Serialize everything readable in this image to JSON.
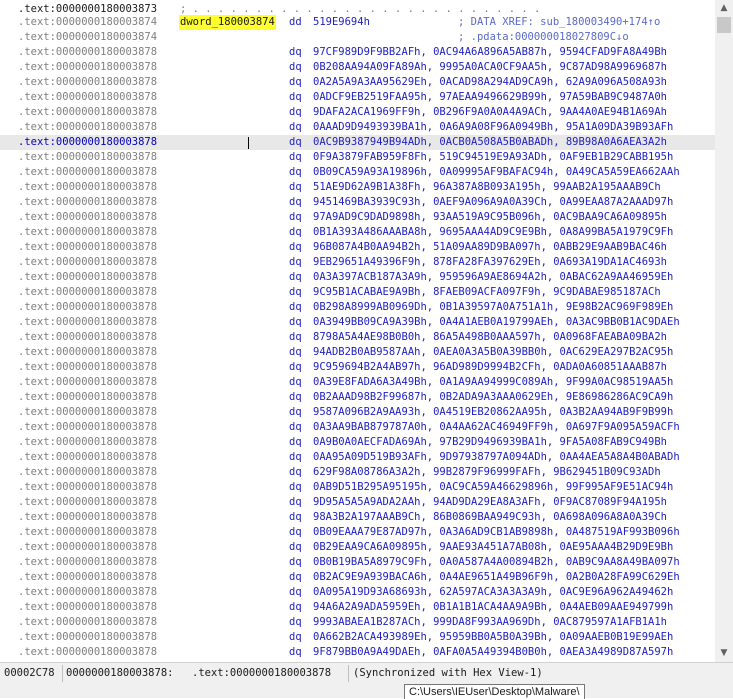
{
  "listing": {
    "header": {
      "address": ".text:0000000180003873",
      "trailing_dots": "; . . . . . . . . . . . . . . . . . . . . . . . . . . . ."
    },
    "label_line": {
      "address": ".text:0000000180003874",
      "label": "dword_180003874",
      "mnemonic": "dd",
      "operand": "519E9694h",
      "comment": "; DATA XREF: sub_180003490+174↑o"
    },
    "comment_line": {
      "address": ".text:0000000180003874",
      "comment": "; .pdata:000000018027809C↓o"
    },
    "row_address": ".text:0000000180003878",
    "mnemonic": "dq",
    "current_index": 6,
    "rows": [
      "97CF989D9F9BB2AFh, 0AC94A6A896A5AB87h, 9594CFAD9FA8A49Bh",
      "0B208AA94A09FA89Ah, 9995A0ACA0CF9AA5h, 9C87AD98A9969687h",
      "0A2A5A9A3AA95629Eh, 0ACAD98A294AD9CA9h, 62A9A096A508A93h",
      "0ADCF9EB2519FAA95h, 97AEAA9496629B99h, 97A59BAB9C9487A0h",
      "9DAFA2ACA1969FF9h, 0B296F9A0A0A4A9ACh, 9AA4A0AE94B1A69Ah",
      "0AAAD9D9493939BA1h, 0A6A9A08F96A0949Bh, 95A1A09DA39B93AFh",
      "0AC9B9387949B94ADh, 0ACB0A508A5B0ABADh, 89B98A0A6AEA3A2h",
      "0F9A3879FAB959F8Fh, 519C94519E9A93ADh, 0AF9EB1B29CABB195h",
      "0B09CA59A93A19896h, 0A09995AF9BAFAC94h, 0A49CA5A59EA662AAh",
      "51AE9D62A9B1A38Fh, 96A387A8B093A195h, 99AAB2A195AAAB9Ch",
      "9451469BA3939C93h, 0AEF9A096A9A0A39Ch, 0A99EAA87A2AAAD97h",
      "97A9AD9C9DAD9898h, 93AA519A9C95B096h, 0AC9BAA9CA6A09895h",
      "0B1A393A486AAABA8h, 9695AAA4AD9C9E9Bh, 0A8A99BA5A1979C9Fh",
      "96B087A4B0AA94B2h, 51A09AA89D9BA097h, 0ABB29E9AAB9BAC46h",
      "9EB29651A49396F9h, 878FA28FA397629Eh, 0A693A19DA1AC4693h",
      "0A3A397ACB187A3A9h, 959596A9AE8694A2h, 0ABAC62A9AA46959Eh",
      "9C95B1ACABAE9A9Bh, 8FAEB09ACFA097F9h, 9C9DABAE985187ACh",
      "0B298A8999AB0969Dh, 0B1A39597A0A751A1h, 9E98B2AC969F989Eh",
      "0A3949BB09CA9A39Bh, 0A4A1AEB0A19799AEh, 0A3AC9BB0B1AC9DAEh",
      "8798A5A4AE98B0B0h, 86A5A498B0AAA597h, 0A0968FAEABA09BA2h",
      "94ADB2B0AB9587AAh, 0AEA0A3A5B0A39BB0h, 0AC629EA297B2AC95h",
      "9C959694B2A4AB97h, 96AD989D9994B2CFh, 0ADA0A60851AAAB87h",
      "0A39E8FADA6A3A49Bh, 0A1A9AA94999C089Ah, 9F99A0AC98519AA5h",
      "0B2AAAD98B2F99687h, 0B2ADA9A3AAA0629Eh, 9E86986286AC9CA9h",
      "9587A096B2A9AA93h, 0A4519EB20862AA95h, 0A3B2AA94AB9F9B99h",
      "0A3AA9BAB879787A0h, 0A4AA62AC46949FF9h, 0A697F9A095A59ACFh",
      "0A9B0A0AECFADA69Ah, 97B29D9496939BA1h, 9FA5A08FAB9C949Bh",
      "0AA95A09D519B93AFh, 9D97938797A094ADh, 0AA4AEA5A8A4B0ABADh",
      "629F98A08786A3A2h, 99B2879F96999FAFh, 9B629451B09C93ADh",
      "0AB9D51B295A95195h, 0AC9CA59A46629896h, 99F995AF9E51AC94h",
      "9D95A5A5A9ADA2AAh, 94AD9DA29EA8A3AFh, 0F9AC87089F94A195h",
      "98A3B2A197AAAB9Ch, 86B0869BAA949C93h, 0A698A096A8A0A39Ch",
      "0B09EAAA79E87AD97h, 0A3A6AD9CB1AB9898h, 0A487519AF993B096h",
      "0B29EAA9CA6A09895h, 9AAE93A451A7AB08h, 0AE95AAA4B29D9E9Bh",
      "0B0B19BA5A8979C9Fh, 0A0A587A4A00894B2h, 0AB9C9AA8A49BA097h",
      "0B2AC9E9A939BACA6h, 0A4AE9651A49B96F9h, 0A2B0A28FA99C629Eh",
      "0A095A19D93A68693h, 62A597ACA3A3A3A9h, 0AC9E96A962A49462h",
      "94A6A2A9ADA5959Eh, 0B1A1B1ACA4AA9A9Bh, 0A4AEB09AAE949799h",
      "9993ABAEA1B287ACh, 999DA8F993AA969Dh, 0AC879597A1AFB1A1h",
      "0A662B2ACA493989Eh, 95959BB0A5B0A39Bh, 0A09AAEB0B19E99AEh",
      "9F879BB0A9A49DAEh, 0AFA0A5A49394B0B0h, 0AEA3A4989D87A597h"
    ]
  },
  "status": {
    "offset": "00002C78",
    "address": "0000000180003878:",
    "location": ".text:0000000180003878",
    "sync": "(Synchronized with Hex View-1)"
  },
  "tooltip": {
    "path": "C:\\Users\\IEUser\\Desktop\\Malware\\"
  },
  "scrollbar": {
    "up_arrow": "up-arrow-icon",
    "down_arrow": "down-arrow-icon",
    "position_fraction": 0.0
  }
}
